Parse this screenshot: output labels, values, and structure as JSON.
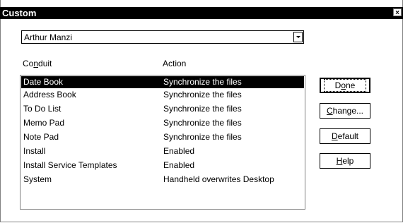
{
  "window": {
    "title": "Custom",
    "close_glyph": "×"
  },
  "user_select": {
    "value": "Arthur Manzi"
  },
  "columns": {
    "conduit": {
      "pre": "Co",
      "ul": "n",
      "post": "duit"
    },
    "action": "Action"
  },
  "rows": [
    {
      "conduit": "Date Book",
      "action": "Synchronize the files",
      "selected": true
    },
    {
      "conduit": "Address Book",
      "action": "Synchronize the files"
    },
    {
      "conduit": "To Do List",
      "action": "Synchronize the files"
    },
    {
      "conduit": "Memo Pad",
      "action": "Synchronize the files"
    },
    {
      "conduit": "Note Pad",
      "action": "Synchronize the files"
    },
    {
      "conduit": "Install",
      "action": "Enabled"
    },
    {
      "conduit": "Install Service Templates",
      "action": "Enabled"
    },
    {
      "conduit": "System",
      "action": "Handheld overwrites Desktop"
    }
  ],
  "buttons": {
    "done": {
      "pre": "D",
      "ul": "o",
      "post": "ne"
    },
    "change": {
      "pre": "",
      "ul": "C",
      "post": "hange..."
    },
    "default": {
      "pre": "",
      "ul": "D",
      "post": "efault"
    },
    "help": {
      "pre": "",
      "ul": "H",
      "post": "elp"
    }
  }
}
